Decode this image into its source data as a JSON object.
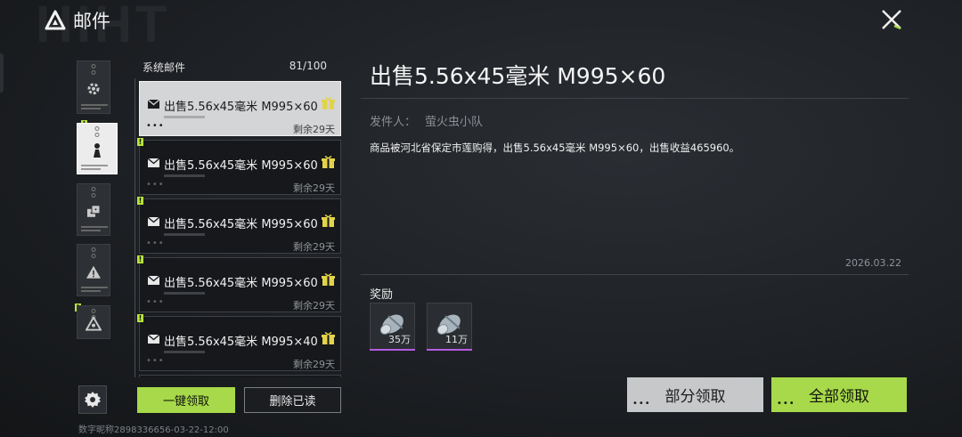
{
  "header": {
    "watermark": "HIHT",
    "title": "邮件"
  },
  "list": {
    "header_label": "系统邮件",
    "count": "81/100",
    "mails": [
      {
        "subject": "出售5.56x45毫米 M995×60",
        "days": "剩余29天",
        "selected": true
      },
      {
        "subject": "出售5.56x45毫米 M995×60",
        "days": "剩余29天",
        "selected": false
      },
      {
        "subject": "出售5.56x45毫米 M995×60",
        "days": "剩余29天",
        "selected": false
      },
      {
        "subject": "出售5.56x45毫米 M995×60",
        "days": "剩余29天",
        "selected": false
      },
      {
        "subject": "出售5.56x45毫米 M995×40",
        "days": "剩余29天",
        "selected": false
      }
    ],
    "claim_one_label": "一键领取",
    "delete_read_label": "删除已读"
  },
  "detail": {
    "title": "出售5.56x45毫米 M995×60",
    "sender_label": "发件人：",
    "sender_name": "萤火虫小队",
    "body": "商品被河北省保定市莲购得，出售5.56x45毫米 M995×60，出售收益465960。",
    "date": "2026.03.22",
    "rewards_label": "奖励",
    "rewards": [
      {
        "icon": "currency-roll-icon",
        "qty": "35万"
      },
      {
        "icon": "currency-roll-icon",
        "qty": "11万"
      }
    ],
    "partial_claim_label": "部分领取",
    "claim_all_label": "全部领取"
  },
  "footer": {
    "text": "数字昵称2898336656-03-22-12:00"
  },
  "colors": {
    "accent": "#a7d94a",
    "badge": "#b7e33b",
    "rarity_purple": "#b65be3"
  }
}
